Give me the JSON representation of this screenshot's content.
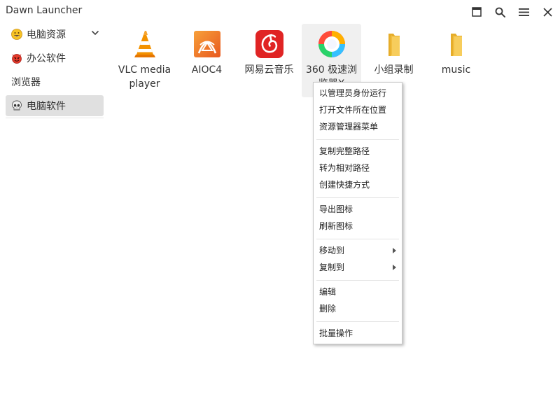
{
  "window": {
    "title": "Dawn Launcher"
  },
  "titlebar": {
    "buttons": [
      {
        "name": "maximize-icon"
      },
      {
        "name": "search-icon"
      },
      {
        "name": "menu-icon"
      },
      {
        "name": "close-icon"
      }
    ]
  },
  "sidebar": {
    "items": [
      {
        "label": "电脑资源",
        "icon": "grinning-face-icon",
        "expanded": true
      },
      {
        "label": "办公软件",
        "icon": "devil-face-icon"
      },
      {
        "label": "浏览器",
        "icon": ""
      },
      {
        "label": "电脑软件",
        "icon": "skull-icon",
        "selected": true
      }
    ]
  },
  "apps": [
    {
      "label": "VLC media player",
      "icon": "vlc-cone-icon"
    },
    {
      "label": "AIOC4",
      "icon": "aioc4-icon"
    },
    {
      "label": "网易云音乐",
      "icon": "netease-music-icon"
    },
    {
      "label": "360 极速浏览器X",
      "icon": "360-browser-icon",
      "hovered": true
    },
    {
      "label": "小组录制",
      "icon": "folder-icon"
    },
    {
      "label": "music",
      "icon": "folder-icon"
    }
  ],
  "context_menu": {
    "groups": [
      [
        "以管理员身份运行",
        "打开文件所在位置",
        "资源管理器菜单"
      ],
      [
        "复制完整路径",
        "转为相对路径",
        "创建快捷方式"
      ],
      [
        "导出图标",
        "刷新图标"
      ],
      [
        "移动到",
        "复制到"
      ],
      [
        "编辑",
        "删除"
      ],
      [
        "批量操作"
      ]
    ],
    "submenu_items": [
      "移动到",
      "复制到"
    ]
  },
  "colors": {
    "selected_bg": "#e0e0e0",
    "hover_bg": "#f0f0f0",
    "vlc_orange": "#f08a00",
    "netease_red": "#e02424",
    "folder_yellow": "#f7cd5c"
  }
}
